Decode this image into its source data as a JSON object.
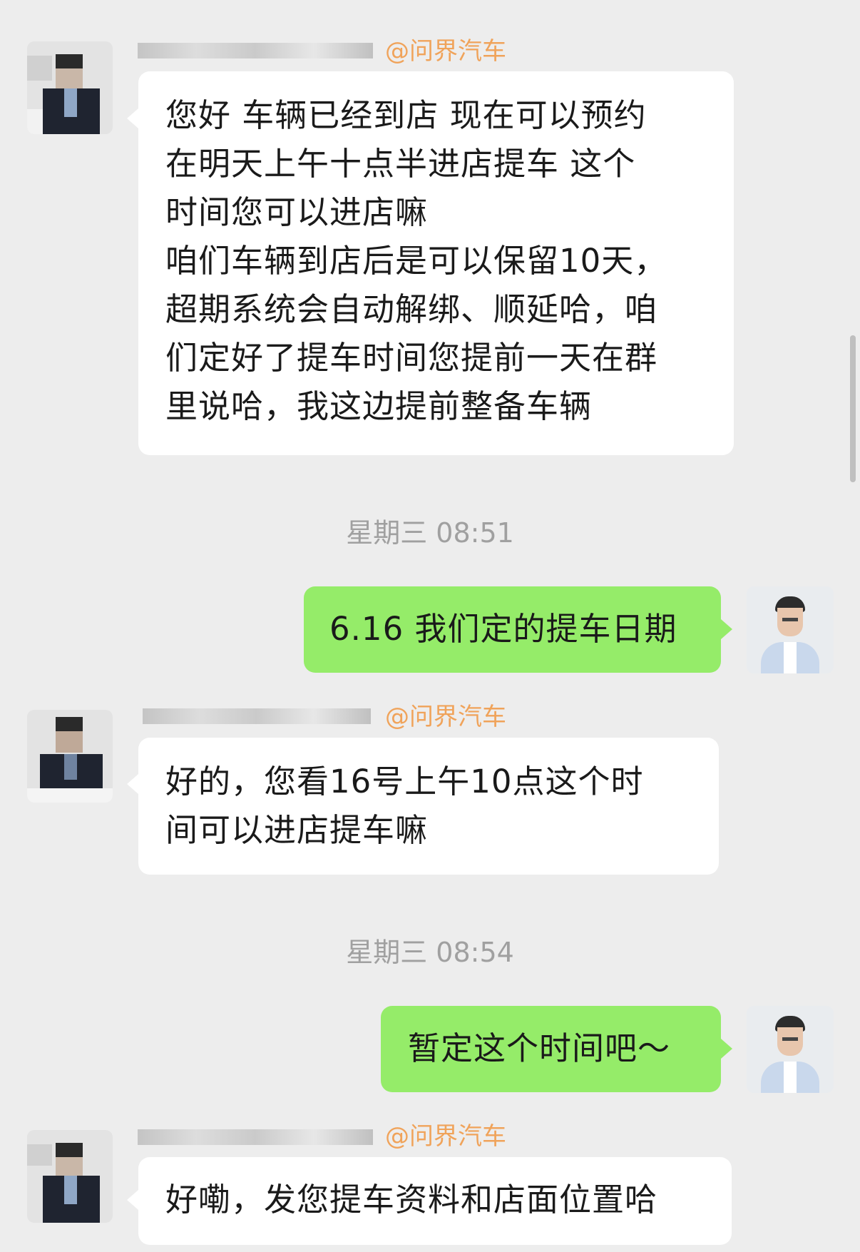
{
  "messages": [
    {
      "side": "left",
      "org": "@问界汽车",
      "lines": [
        "您好  车辆已经到店 现在可以预约",
        "在明天上午十点半进店提车  这个",
        "时间您可以进店嘛",
        "咱们车辆到店后是可以保留10天，",
        "超期系统会自动解绑、顺延哈，咱",
        "们定好了提车时间您提前一天在群",
        "里说哈，我这边提前整备车辆"
      ]
    },
    {
      "timestamp": "星期三 08:51"
    },
    {
      "side": "right",
      "lines": [
        "6.16 我们定的提车日期"
      ]
    },
    {
      "side": "left",
      "org": "@问界汽车",
      "lines": [
        "好的，您看16号上午10点这个时",
        "间可以进店提车嘛"
      ]
    },
    {
      "timestamp": "星期三 08:54"
    },
    {
      "side": "right",
      "lines": [
        "暂定这个时间吧～"
      ]
    },
    {
      "side": "left",
      "org": "@问界汽车",
      "lines": [
        "好嘞，发您提车资料和店面位置哈"
      ]
    }
  ],
  "colors": {
    "background": "#ededed",
    "left_bubble": "#ffffff",
    "right_bubble": "#95ec69",
    "org_tag": "#f0a35a",
    "timestamp": "#a0a0a0"
  },
  "icons": [
    "pixelated-avatar",
    "user-avatar"
  ]
}
